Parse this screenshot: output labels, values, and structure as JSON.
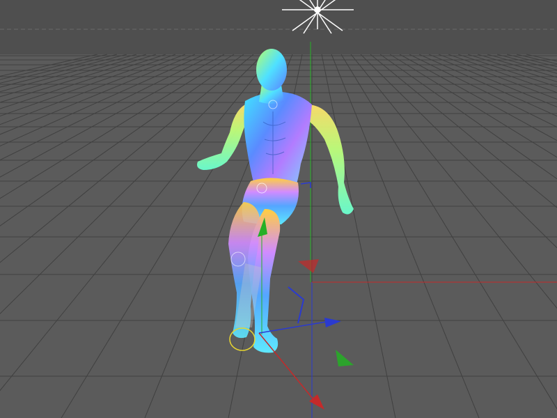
{
  "viewport": {
    "view_name": "perspective-3d-viewport",
    "colors": {
      "background_sky": "#4f4f4f",
      "floor": "#5b5b5b",
      "grid_line": "#3f3f3f",
      "x_axis": "#c42a2a",
      "y_axis": "#25b025",
      "z_axis": "#2a3ad0",
      "selection_ring": "#e8d630",
      "light_rays": "#ffffff"
    }
  },
  "scene": {
    "objects": [
      {
        "type": "light",
        "icon": "omni-light-icon"
      },
      {
        "type": "figure",
        "icon": "human-figure",
        "shading": "normal-map-rainbow"
      },
      {
        "type": "gizmo",
        "icon": "transform-gizmo"
      }
    ]
  }
}
